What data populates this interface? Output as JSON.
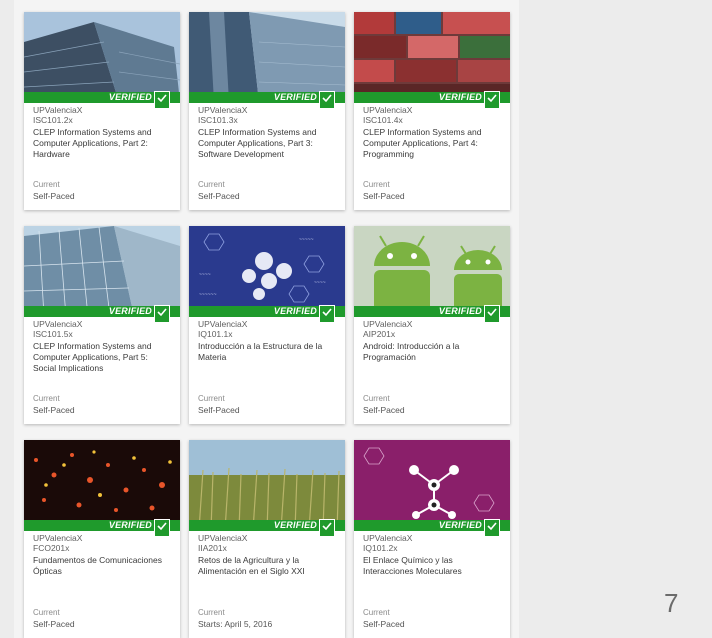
{
  "badge_label": "VERIFIED",
  "colors": {
    "verified_green": "#1f9a2c",
    "card_bg": "#ffffff",
    "panel_bg": "#f4f4f4"
  },
  "courses": [
    {
      "org": "UPValenciaX",
      "code": "ISC101.2x",
      "title": "CLEP Information Systems and Computer Applications, Part 2: Hardware",
      "status": "Current",
      "pace": "Self-Paced",
      "thumb": "building-glass"
    },
    {
      "org": "UPValenciaX",
      "code": "ISC101.3x",
      "title": "CLEP Information Systems and Computer Applications, Part 3: Software Development",
      "status": "Current",
      "pace": "Self-Paced",
      "thumb": "building-sky"
    },
    {
      "org": "UPValenciaX",
      "code": "ISC101.4x",
      "title": "CLEP Information Systems and Computer Applications, Part 4: Programming",
      "status": "Current",
      "pace": "Self-Paced",
      "thumb": "stacked-containers"
    },
    {
      "org": "UPValenciaX",
      "code": "ISC101.5x",
      "title": "CLEP Information Systems and Computer Applications, Part 5: Social Implications",
      "status": "Current",
      "pace": "Self-Paced",
      "thumb": "glass-facade"
    },
    {
      "org": "UPValenciaX",
      "code": "IQ101.1x",
      "title": "Introducción a la Estructura de la Materia",
      "status": "Current",
      "pace": "Self-Paced",
      "thumb": "molecules-blue"
    },
    {
      "org": "UPValenciaX",
      "code": "AIP201x",
      "title": "Android: Introducción a la Programación",
      "status": "Current",
      "pace": "Self-Paced",
      "thumb": "android-robots"
    },
    {
      "org": "UPValenciaX",
      "code": "FCO201x",
      "title": "Fundamentos de Comunicaciones Ópticas",
      "status": "Current",
      "pace": "Self-Paced",
      "thumb": "light-dots"
    },
    {
      "org": "UPValenciaX",
      "code": "IIA201x",
      "title": "Retos de la Agricultura y la Alimentación en el Siglo XXI",
      "status": "Current",
      "pace": "Starts: April 5, 2016",
      "thumb": "wheat-field"
    },
    {
      "org": "UPValenciaX",
      "code": "IQ101.2x",
      "title": "El Enlace Químico y las Interacciones Moleculares",
      "status": "Current",
      "pace": "Self-Paced",
      "thumb": "molecules-purple"
    }
  ],
  "page_number": "7"
}
